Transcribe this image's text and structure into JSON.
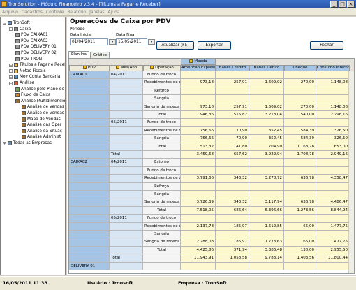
{
  "window": {
    "title": "TronSolution - Módulo Financeiro v.3.4 - [Títulos a Pagar e Receber]"
  },
  "menu": [
    "Arquivo",
    "Cadastros",
    "Controle",
    "Relatório",
    "Janelas",
    "Ajuda"
  ],
  "tree": [
    {
      "label": "TronSoft",
      "icon": "computer-icon",
      "level": 0
    },
    {
      "label": "Caixa",
      "icon": "cashbox-icon",
      "level": 1
    },
    {
      "label": "PDV CAIXA01",
      "icon": "register-icon",
      "level": 2
    },
    {
      "label": "PDV CAIXA02",
      "icon": "register-icon",
      "level": 2
    },
    {
      "label": "PDV DELIVERY 01",
      "icon": "register-icon",
      "level": 2
    },
    {
      "label": "PDV DELIVERY 02",
      "icon": "register-icon",
      "level": 2
    },
    {
      "label": "PDV TRON",
      "icon": "register-icon",
      "level": 2
    },
    {
      "label": "Títulos a Pagar e Receber",
      "icon": "document-icon",
      "level": 1
    },
    {
      "label": "Notas Fiscais",
      "icon": "document-icon",
      "level": 1
    },
    {
      "label": "Mov Conta Bancária",
      "icon": "bank-icon",
      "level": 1
    },
    {
      "label": "Análise",
      "icon": "chart-icon",
      "level": 1
    },
    {
      "label": "Análise pelo Plano de",
      "icon": "analysis-icon",
      "level": 2
    },
    {
      "label": "Fluxo de Caixa",
      "icon": "flow-icon",
      "level": 2
    },
    {
      "label": "Análise Multidimensio",
      "icon": "cube-icon",
      "level": 2
    },
    {
      "label": "Análise de Vendas",
      "icon": "cube-icon",
      "level": 3
    },
    {
      "label": "Análise de Vendas",
      "icon": "cube-icon",
      "level": 3
    },
    {
      "label": "Mapa de Vendas",
      "icon": "cube-icon",
      "level": 3
    },
    {
      "label": "Análise das Oper",
      "icon": "cube-icon",
      "level": 3
    },
    {
      "label": "Análise da Situaç",
      "icon": "cube-icon",
      "level": 3
    },
    {
      "label": "Análise Administ",
      "icon": "cube-icon",
      "level": 3
    },
    {
      "label": "Todas as Empresas",
      "icon": "building-icon",
      "level": 0
    }
  ],
  "page": {
    "title": "Operações de Caixa por PDV",
    "period_label": "Período",
    "start_label": "Data Inicial",
    "start_value": "01/04/2011",
    "end_label": "Data Final",
    "end_value": "15/05/2011",
    "btn_update": "Atualizar (F5)",
    "btn_export": "Exportar",
    "btn_close": "Fechar"
  },
  "tabs": [
    "Planilha",
    "Gráfico"
  ],
  "grid": {
    "group_header": "Moeda",
    "row_headers": [
      "PDV",
      "Mês/Ano",
      "Operação"
    ],
    "columns": [
      "American Express",
      "Banes Credito",
      "Banes Debito",
      "Cheque",
      "Consumo Interno"
    ],
    "rows": [
      {
        "pdv": "CAIXA01",
        "mes": "04/2011",
        "op": "Fundo de troco",
        "v": [
          "",
          "",
          "",
          "",
          ""
        ]
      },
      {
        "pdv": "",
        "mes": "",
        "op": "Recebimentos de con",
        "v": [
          "973,18",
          "257,91",
          "1.609,02",
          "270,00",
          "1.148,08"
        ]
      },
      {
        "pdv": "",
        "mes": "",
        "op": "Reforço",
        "v": [
          "",
          "",
          "",
          "",
          ""
        ]
      },
      {
        "pdv": "",
        "mes": "",
        "op": "Sangria",
        "v": [
          "",
          "",
          "",
          "",
          ""
        ]
      },
      {
        "pdv": "",
        "mes": "",
        "op": "Sangria de moeda nã",
        "v": [
          "973,18",
          "257,91",
          "1.609,02",
          "270,00",
          "1.148,08"
        ]
      },
      {
        "pdv": "",
        "mes": "",
        "op": "Total",
        "v": [
          "1.946,36",
          "515,82",
          "3.218,04",
          "540,00",
          "2.296,16"
        ]
      },
      {
        "pdv": "",
        "mes": "05/2011",
        "op": "Fundo de troco",
        "v": [
          "",
          "",
          "",
          "",
          ""
        ]
      },
      {
        "pdv": "",
        "mes": "",
        "op": "Recebimentos de con",
        "v": [
          "756,66",
          "70,90",
          "352,45",
          "584,39",
          "326,50"
        ]
      },
      {
        "pdv": "",
        "mes": "",
        "op": "Sangria",
        "v": [
          "756,66",
          "70,90",
          "352,45",
          "584,39",
          "326,50"
        ]
      },
      {
        "pdv": "",
        "mes": "",
        "op": "Total",
        "v": [
          "1.513,32",
          "141,80",
          "704,90",
          "1.168,78",
          "653,00"
        ]
      },
      {
        "pdv": "",
        "mes": "Total",
        "op": "",
        "v": [
          "3.459,68",
          "657,62",
          "3.922,94",
          "1.708,78",
          "2.949,16"
        ]
      },
      {
        "pdv": "CAIXA02",
        "mes": "04/2011",
        "op": "Estorno",
        "v": [
          "",
          "",
          "",
          "",
          ""
        ]
      },
      {
        "pdv": "",
        "mes": "",
        "op": "Fundo de troco",
        "v": [
          "",
          "",
          "",
          "",
          ""
        ]
      },
      {
        "pdv": "",
        "mes": "",
        "op": "Recebimentos de con",
        "v": [
          "3.791,66",
          "343,32",
          "3.278,72",
          "636,78",
          "4.358,47"
        ]
      },
      {
        "pdv": "",
        "mes": "",
        "op": "Reforço",
        "v": [
          "",
          "",
          "",
          "",
          ""
        ]
      },
      {
        "pdv": "",
        "mes": "",
        "op": "Sangria",
        "v": [
          "",
          "",
          "",
          "",
          ""
        ]
      },
      {
        "pdv": "",
        "mes": "",
        "op": "Sangria de moeda nã",
        "v": [
          "3.726,39",
          "343,32",
          "3.117,94",
          "636,78",
          "4.486,47"
        ]
      },
      {
        "pdv": "",
        "mes": "",
        "op": "Total",
        "v": [
          "7.518,05",
          "686,64",
          "6.396,66",
          "1.273,56",
          "8.844,94"
        ]
      },
      {
        "pdv": "",
        "mes": "05/2011",
        "op": "Fundo de troco",
        "v": [
          "",
          "",
          "",
          "",
          ""
        ]
      },
      {
        "pdv": "",
        "mes": "",
        "op": "Recebimentos de con",
        "v": [
          "2.137,78",
          "185,97",
          "1.612,85",
          "65,00",
          "1.477,75"
        ]
      },
      {
        "pdv": "",
        "mes": "",
        "op": "Sangria",
        "v": [
          "",
          "",
          "",
          "",
          ""
        ]
      },
      {
        "pdv": "",
        "mes": "",
        "op": "Sangria de moeda nã",
        "v": [
          "2.288,08",
          "185,97",
          "1.773,63",
          "65,00",
          "1.477,75"
        ]
      },
      {
        "pdv": "",
        "mes": "",
        "op": "Total",
        "v": [
          "4.425,86",
          "371,94",
          "3.386,48",
          "130,00",
          "2.955,50"
        ]
      },
      {
        "pdv": "",
        "mes": "Total",
        "op": "",
        "v": [
          "11.943,91",
          "1.058,58",
          "9.783,14",
          "1.403,56",
          "11.800,44"
        ]
      },
      {
        "pdv": "DELIVERY 01",
        "mes": "",
        "op": "",
        "v": [
          "",
          "",
          "",
          "",
          ""
        ]
      }
    ]
  },
  "status": {
    "datetime": "16/05/2011 11:38",
    "user": "Usuário : Tronsoft",
    "company": "Empresa : TronSoft"
  }
}
